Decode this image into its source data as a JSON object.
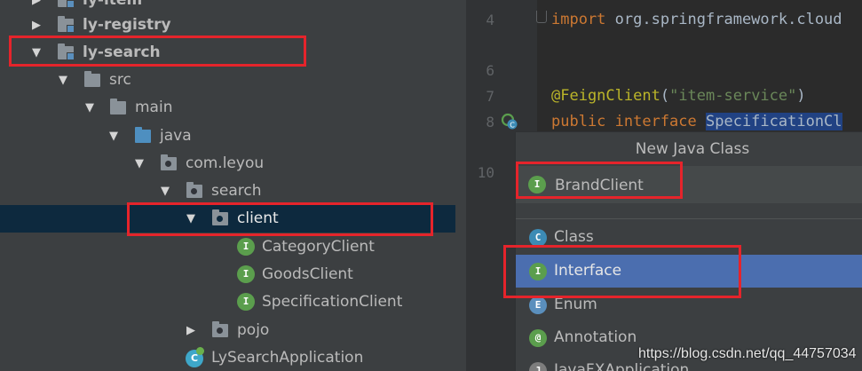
{
  "tree": {
    "items": [
      {
        "label": "ly-item",
        "type": "module",
        "bold": true
      },
      {
        "label": "ly-registry",
        "type": "module",
        "bold": true
      },
      {
        "label": "ly-search",
        "type": "module",
        "bold": true
      },
      {
        "label": "src",
        "type": "folder"
      },
      {
        "label": "main",
        "type": "folder"
      },
      {
        "label": "java",
        "type": "source-folder"
      },
      {
        "label": "com.leyou",
        "type": "package"
      },
      {
        "label": "search",
        "type": "package"
      },
      {
        "label": "client",
        "type": "package",
        "selected": true
      },
      {
        "label": "CategoryClient",
        "type": "interface"
      },
      {
        "label": "GoodsClient",
        "type": "interface"
      },
      {
        "label": "SpecificationClient",
        "type": "interface"
      },
      {
        "label": "pojo",
        "type": "package"
      },
      {
        "label": "LySearchApplication",
        "type": "spring-class"
      }
    ]
  },
  "editor": {
    "line_numbers": [
      "4",
      "6",
      "7",
      "8",
      "10"
    ],
    "import_kw": "import",
    "import_rest": " org.springframework.cloud",
    "annotation": "@FeignClient",
    "annotation_open": "(",
    "annotation_arg": "\"item-service\"",
    "annotation_close": ")",
    "decl_kw": "public interface ",
    "class_name": "SpecificationCl"
  },
  "popup": {
    "title": "New Java Class",
    "name_value": "BrandClient",
    "options": [
      {
        "label": "Class",
        "icon": "C",
        "color": "#3c8bb5"
      },
      {
        "label": "Interface",
        "icon": "I",
        "color": "#5b9e4d"
      },
      {
        "label": "Enum",
        "icon": "E",
        "color": "#5a8fbd"
      },
      {
        "label": "Annotation",
        "icon": "@",
        "color": "#5b9e4d"
      },
      {
        "label": "JavaFXApplication",
        "icon": "J",
        "color": "#7d7d7d"
      }
    ],
    "selected_option": "Interface"
  },
  "watermark": "https://blog.csdn.net/qq_44757034",
  "colors": {
    "highlight_red": "#e5242b",
    "selection_blue": "#4b6eaf",
    "tree_selected": "#0d293e"
  }
}
